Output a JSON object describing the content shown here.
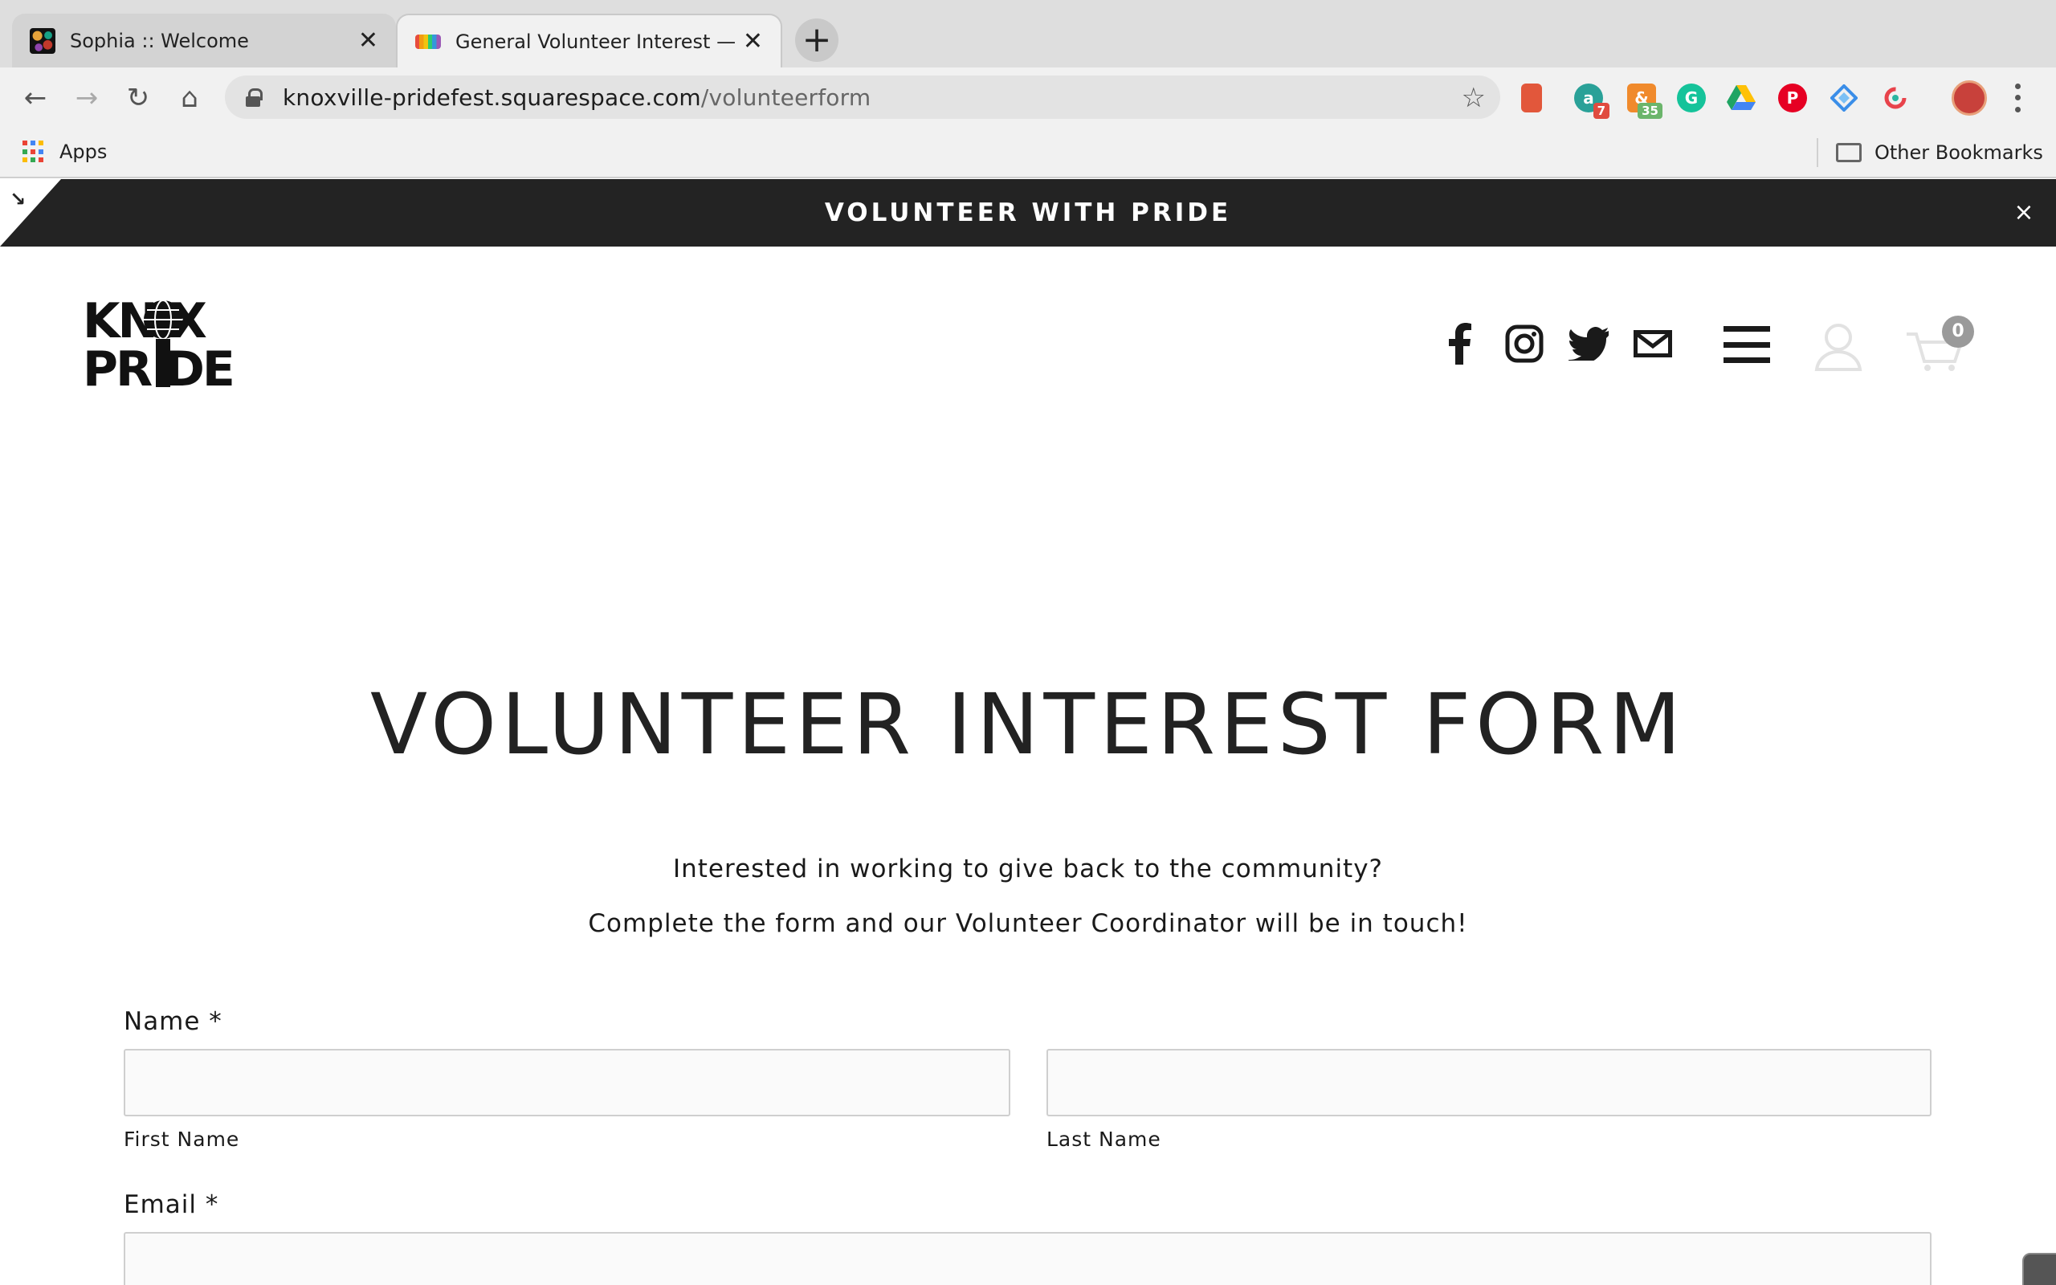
{
  "browser": {
    "tabs": [
      {
        "title": "Sophia :: Welcome",
        "active": false
      },
      {
        "title": "General Volunteer Interest — K",
        "active": true
      }
    ],
    "new_tab": "+",
    "url_host": "knoxville-pridefest.squarespace.com",
    "url_path": "/volunteerform",
    "extensions": [
      {
        "name": "office-icon",
        "color": "#e2573b",
        "badge": ""
      },
      {
        "name": "extension-a-icon",
        "color": "#2aa198",
        "badge": "7",
        "badge_color": "#e04b3f"
      },
      {
        "name": "extension-ampersand-icon",
        "color": "#f08a2c",
        "badge": "35",
        "badge_color": "#6bb56b"
      },
      {
        "name": "grammarly-icon",
        "color": "#15c39a",
        "badge": ""
      },
      {
        "name": "google-drive-icon",
        "color": "#1fa463",
        "badge": ""
      },
      {
        "name": "pinterest-icon",
        "color": "#e60023",
        "badge": ""
      },
      {
        "name": "diamond-extension-icon",
        "color": "#3b8ee8",
        "badge": ""
      },
      {
        "name": "c-extension-icon",
        "color": "#e8434b",
        "badge": ""
      }
    ],
    "bookmarks": {
      "apps_label": "Apps",
      "other_label": "Other Bookmarks"
    }
  },
  "announcement": {
    "text": "VOLUNTEER WITH PRIDE",
    "close": "×"
  },
  "header": {
    "logo_line1": "KN   X",
    "logo_line2": "PR DE",
    "socials": [
      "facebook-icon",
      "instagram-icon",
      "twitter-icon",
      "email-icon"
    ],
    "cart_count": "0"
  },
  "main": {
    "title": "VOLUNTEER INTEREST FORM",
    "intro_line1": "Interested in working to give back to the community?",
    "intro_line2": "Complete the form and our Volunteer Coordinator will be in touch!"
  },
  "form": {
    "name_label": "Name *",
    "first_name_label": "First Name",
    "last_name_label": "Last Name",
    "first_name_value": "",
    "last_name_value": "",
    "email_label": "Email *",
    "email_value": ""
  },
  "colors": {
    "announcement_bg": "#232323",
    "text": "#1a1a1a"
  }
}
